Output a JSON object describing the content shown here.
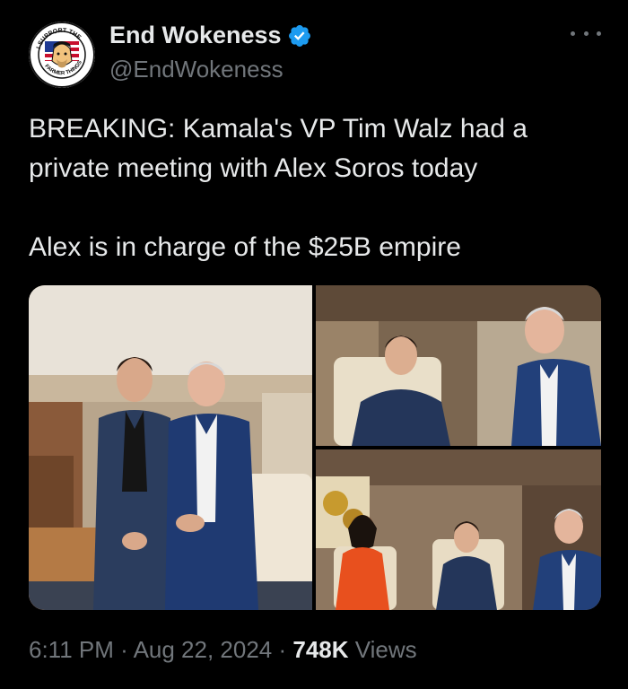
{
  "tweet": {
    "author": {
      "display_name": "End Wokeness",
      "handle": "@EndWokeness",
      "verified": true,
      "avatar_text_top": "I SUPPORT THE",
      "avatar_text_bottom": "FARMER THINGS"
    },
    "text_lines": [
      "BREAKING: Kamala's VP Tim Walz had a",
      "private meeting with Alex Soros today",
      "",
      "Alex is in charge of the $25B empire"
    ],
    "timestamp": "6:11 PM · Aug 22, 2024 · ",
    "views_count": "748K",
    "views_label": " Views"
  },
  "colors": {
    "background": "#000000",
    "primary_text": "#e7e9ea",
    "secondary_text": "#71767b",
    "verified_blue": "#1d9bf0"
  }
}
